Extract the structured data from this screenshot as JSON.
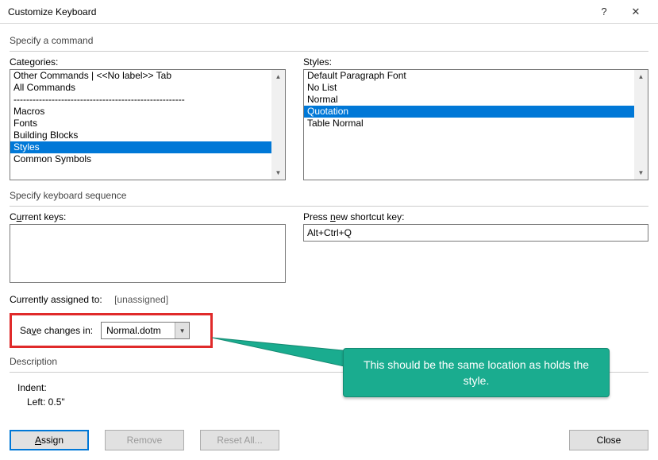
{
  "window": {
    "title": "Customize Keyboard",
    "help_icon": "?",
    "close_icon": "✕"
  },
  "sections": {
    "command": "Specify a command",
    "sequence": "Specify keyboard sequence",
    "description": "Description"
  },
  "categories": {
    "label_pre": "Cate",
    "label_u": "g",
    "label_post": "ories:",
    "items": [
      "Other Commands | <<No label>> Tab",
      "All Commands",
      "------------------------------------------------------",
      "Macros",
      "Fonts",
      "Building Blocks",
      "Styles",
      "Common Symbols"
    ],
    "selected_index": 6
  },
  "styles": {
    "label": "Styles:",
    "items": [
      "Default Paragraph Font",
      "No List",
      "Normal",
      "Quotation",
      "Table Normal"
    ],
    "selected_index": 3
  },
  "current_keys": {
    "label_pre": "C",
    "label_u": "u",
    "label_post": "rrent keys:"
  },
  "press_new": {
    "label_pre": "Press ",
    "label_u": "n",
    "label_post": "ew shortcut key:",
    "value": "Alt+Ctrl+Q"
  },
  "assigned": {
    "label": "Currently assigned to:",
    "value": "[unassigned]"
  },
  "save_in": {
    "label_pre": "Sa",
    "label_u": "v",
    "label_post": "e changes in:",
    "value": "Normal.dotm"
  },
  "description": {
    "line1": "Indent:",
    "line2": "Left:  0.5\""
  },
  "buttons": {
    "assign_u": "A",
    "assign_rest": "ssign",
    "remove": "Remove",
    "reset": "Reset All...",
    "close": "Close"
  },
  "callout": {
    "text": "This should be the same location as holds the style."
  }
}
